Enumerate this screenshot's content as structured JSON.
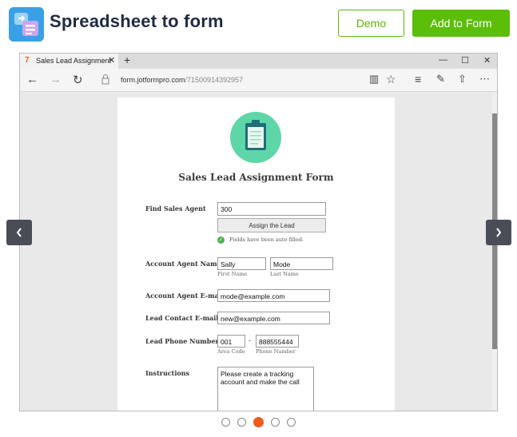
{
  "header": {
    "title": "Spreadsheet to form",
    "demo_label": "Demo",
    "add_label": "Add to Form",
    "accent": "#5bbf0a"
  },
  "browser": {
    "tab_title": "Sales Lead Assignment",
    "url_domain": "form.jotformpro.com",
    "url_path": "/71500914392957"
  },
  "form": {
    "title": "Sales Lead Assignment Form",
    "find_agent_label": "Find Sales Agent",
    "find_agent_value": "300",
    "assign_button": "Assign the Lead",
    "autofill_note": "Fields have been auto filled.",
    "account_agent_name_label": "Account Agent Name",
    "first_name_value": "Sally",
    "last_name_value": "Mode",
    "first_name_sublabel": "First Name",
    "last_name_sublabel": "Last Name",
    "account_agent_email_label": "Account Agent E-mail",
    "account_agent_email_value": "mode@example.com",
    "lead_email_label": "Lead Contact E-mail",
    "lead_email_value": "new@example.com",
    "phone_label": "Lead Phone Number",
    "area_code_value": "001",
    "phone_dash": "-",
    "phone_value": "888555444",
    "area_code_sublabel": "Area Code",
    "phone_sublabel": "Phone Number",
    "instructions_label": "Instructions",
    "instructions_value": "Please create a tracking account and make the call"
  },
  "carousel": {
    "slides": 5,
    "active_index": 2
  }
}
